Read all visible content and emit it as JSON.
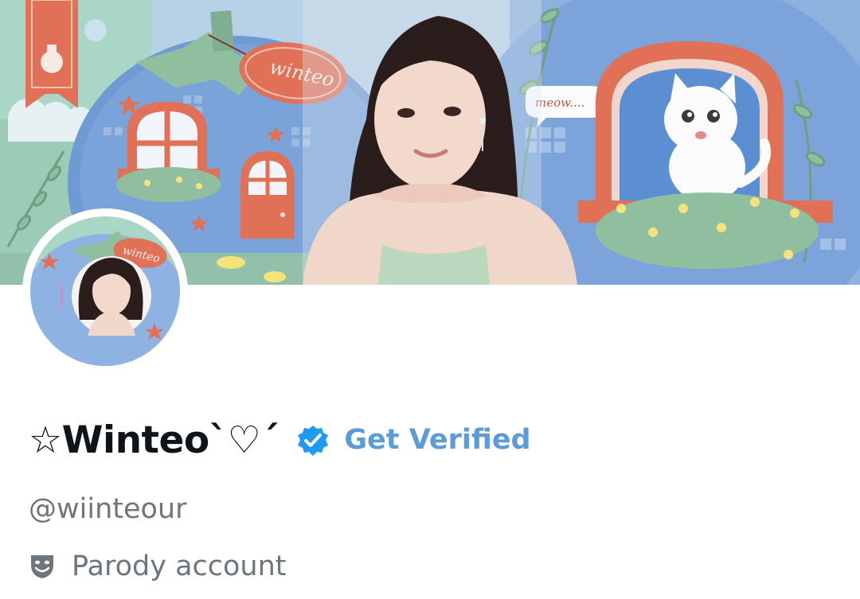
{
  "banner": {
    "sign_text": "winteo",
    "speech_bubble": "meow....",
    "colors": {
      "sky": "#a7c7e0",
      "house_blue": "#6e9bd6",
      "mint": "#a8d4c4",
      "coral": "#e2725b",
      "leaf": "#8cb89a"
    }
  },
  "avatar": {
    "tag_text": "winteo",
    "ring_color": "#ffffff"
  },
  "profile": {
    "display_name": "☆Winteo`♡´",
    "verified_icon": "verified-badge-icon",
    "get_verified_label": "Get Verified",
    "handle": "@wiinteour",
    "parody_icon": "theater-mask-icon",
    "parody_label": "Parody account"
  },
  "colors": {
    "name": "#0f1419",
    "secondary_text": "#6e767d",
    "accent_blue": "#5a9bd8",
    "badge_blue": "#1d9bf0"
  }
}
